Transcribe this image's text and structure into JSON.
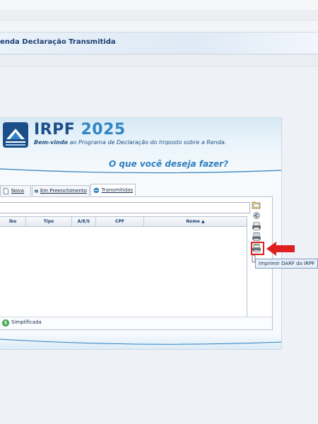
{
  "window": {
    "title": "enda Declaração Transmitida"
  },
  "banner": {
    "logo_title": "IRPF",
    "logo_year": "2025",
    "welcome_bold": "Bem-vindo",
    "welcome_rest": " ao Programa de Declaração do Imposto sobre a Renda.",
    "question": "O que você deseja fazer?"
  },
  "tabs": [
    {
      "label": "Nova",
      "icon": "new-file-icon"
    },
    {
      "label": "Em Preenchimento",
      "icon": "edit-icon"
    },
    {
      "label": "Transmitidas",
      "icon": "transmit-icon"
    }
  ],
  "search": {
    "value": ""
  },
  "table": {
    "columns": [
      "ibo",
      "Tipo",
      "A/E/S",
      "CPF",
      "Nome ▲"
    ]
  },
  "side_actions": [
    {
      "name": "open-folder-icon"
    },
    {
      "name": "back-icon"
    },
    {
      "name": "print-icon"
    },
    {
      "name": "print-receipt-icon"
    },
    {
      "name": "print-darf-icon"
    },
    {
      "name": "more-icon"
    }
  ],
  "tooltip": {
    "text": "Imprimir DARF do IRPF"
  },
  "bottom": {
    "mode_icon": "S",
    "mode_text": "Simplificada"
  },
  "colors": {
    "accent": "#2e7fbf",
    "highlight": "#e02020"
  }
}
